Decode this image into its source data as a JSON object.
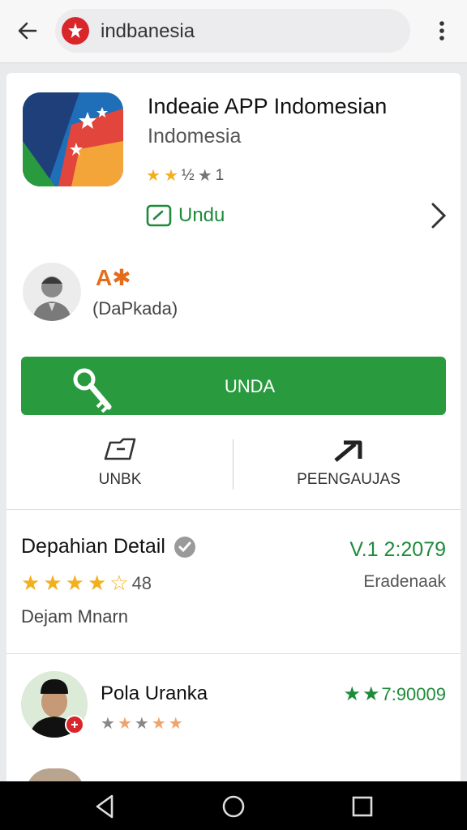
{
  "search": {
    "query": "indbanesia"
  },
  "app": {
    "title": "Indeaie APP Indomesian",
    "developer": "Indomesia",
    "rating_text": "½",
    "rating_count": "1",
    "unduh_label": "Undu"
  },
  "developer_section": {
    "name": "A✱",
    "subtitle": "(DaPkada)"
  },
  "install": {
    "label": "UNDA"
  },
  "actions": {
    "left_label": "UNBK",
    "right_label": "PEENGAUJAS"
  },
  "details": {
    "title": "Depahian Detail",
    "version": "V.1 2:2079",
    "rating_value": "48",
    "label_right": "Eradenaak",
    "description": "Dejam Mnarn"
  },
  "review": {
    "name": "Pola Uranka",
    "score": "7:90009"
  },
  "colors": {
    "accent_green": "#2a9a3f",
    "text_green": "#1e8a3b",
    "star_yellow": "#f2b01e",
    "developer_orange": "#e36d1a",
    "badge_red": "#d8262a"
  },
  "icons": [
    "back-arrow-icon",
    "app-logo-icon",
    "more-vert-icon",
    "chevron-right-icon",
    "person-icon",
    "key-icon",
    "folder-icon",
    "share-arrow-icon",
    "verified-icon",
    "back-triangle-icon",
    "home-circle-icon",
    "recents-square-icon"
  ]
}
